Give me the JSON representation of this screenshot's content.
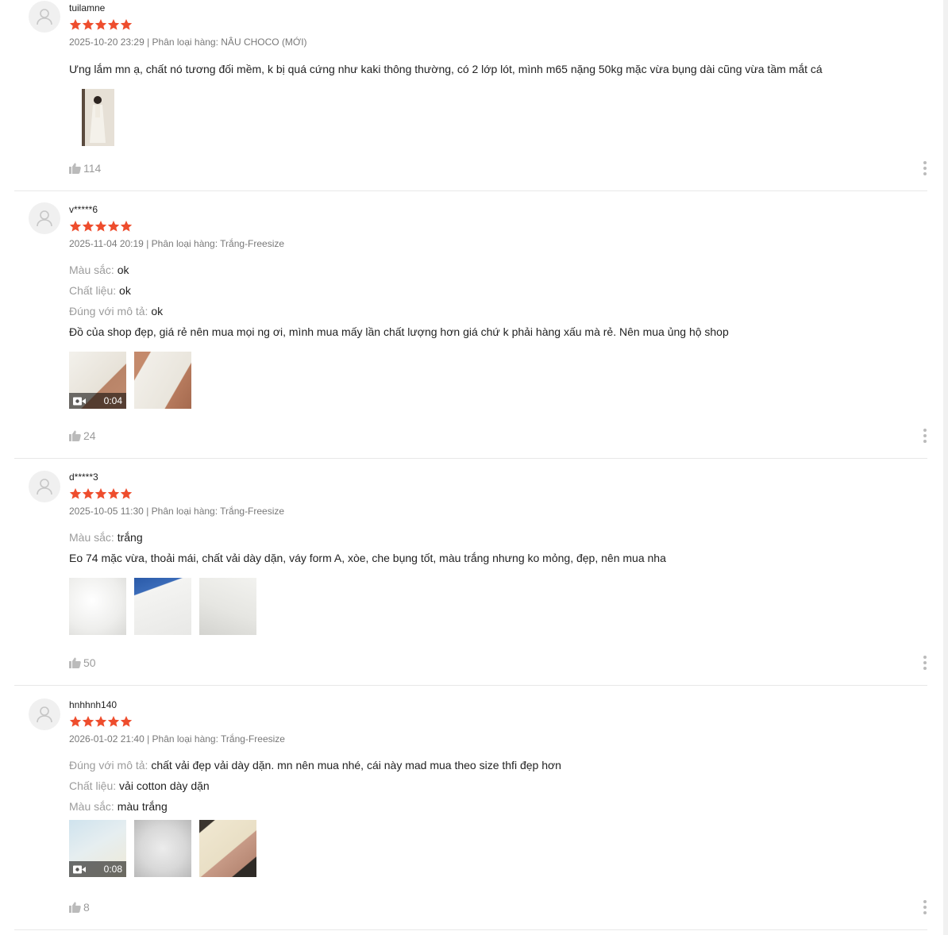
{
  "colors": {
    "star": "#ee4d2d",
    "like_icon": "#bbbbbb",
    "divider": "#e8e8e8"
  },
  "reviews": [
    {
      "username": "tuilamne",
      "rating": 5,
      "meta": "2025-10-20 23:29 | Phân loại hàng: NÂU CHOCO (MỚI)",
      "attributes": [],
      "text": "Ưng lắm mn ạ, chất nó tương đối mềm, k bị quá cứng như kaki thông thường, có 2 lớp lót, mình m65 nặng 50kg mặc vừa bụng dài cũng vừa tầm mắt cá",
      "media": [
        {
          "type": "image",
          "thumb": "photo-of-person-in-dress"
        }
      ],
      "likes": "114"
    },
    {
      "username": "v*****6",
      "rating": 5,
      "meta": "2025-11-04 20:19 | Phân loại hàng: Trắng-Freesize",
      "attributes": [
        {
          "label": "Màu sắc:",
          "value": "ok"
        },
        {
          "label": "Chất liệu:",
          "value": "ok"
        },
        {
          "label": "Đúng với mô tả:",
          "value": "ok"
        }
      ],
      "text": "Đồ của shop đẹp, giá rẻ nên mua mọi ng ơi, mình mua mấy lần chất lượng hơn giá chứ k phải hàng xấu mà rẻ. Nên mua ủng hộ shop",
      "media": [
        {
          "type": "video",
          "duration": "0:04"
        },
        {
          "type": "image"
        }
      ],
      "likes": "24"
    },
    {
      "username": "d*****3",
      "rating": 5,
      "meta": "2025-10-05 11:30 | Phân loại hàng: Trắng-Freesize",
      "attributes": [
        {
          "label": "Màu sắc:",
          "value": "trắng"
        }
      ],
      "text": "Eo 74 mặc vừa, thoải mái, chất vải dày dặn, váy form A, xòe, che bụng tốt, màu trắng nhưng ko mỏng, đẹp, nên mua nha",
      "media": [
        {
          "type": "image"
        },
        {
          "type": "image"
        },
        {
          "type": "image"
        }
      ],
      "likes": "50"
    },
    {
      "username": "hnhhnh140",
      "rating": 5,
      "meta": "2026-01-02 21:40 | Phân loại hàng: Trắng-Freesize",
      "attributes": [
        {
          "label": "Đúng với mô tả:",
          "value": "chất vải đẹp vải dày dặn. mn nên mua nhé, cái này mad mua theo size thfi đẹp hơn"
        },
        {
          "label": "Chất liệu:",
          "value": "vải cotton dày dặn"
        },
        {
          "label": "Màu sắc:",
          "value": "màu trắng"
        }
      ],
      "text": "",
      "media": [
        {
          "type": "video",
          "duration": "0:08"
        },
        {
          "type": "image"
        },
        {
          "type": "image"
        }
      ],
      "likes": "8"
    }
  ]
}
